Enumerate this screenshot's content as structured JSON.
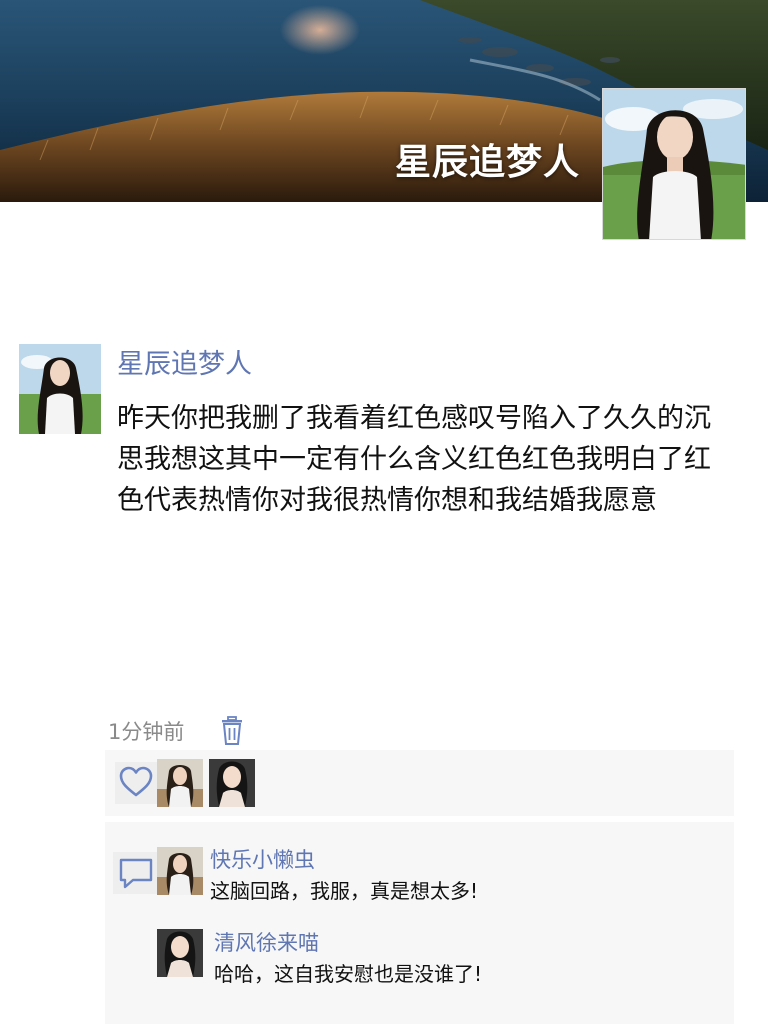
{
  "cover": {
    "user_name": "星辰追梦人"
  },
  "post": {
    "author": "星辰追梦人",
    "content": "昨天你把我删了我看着红色感叹号陷入了久久的沉思我想这其中一定有什么含义红色红色我明白了红色代表热情你对我很热情你想和我结婚我愿意",
    "time": "1分钟前"
  },
  "likes": {
    "icon": "heart-icon",
    "users_avatars": [
      "avatar-1",
      "avatar-2"
    ]
  },
  "comments": {
    "icon": "comment-icon",
    "items": [
      {
        "name": "快乐小懒虫",
        "text": "这脑回路，我服，真是想太多!"
      },
      {
        "name": "清风徐来喵",
        "text": "哈哈，这自我安慰也是没谁了!"
      }
    ]
  },
  "colors": {
    "link_blue": "#5f76b3",
    "text": "#111111",
    "meta_gray": "#8a8a8a",
    "panel_bg": "#f7f7f7"
  }
}
